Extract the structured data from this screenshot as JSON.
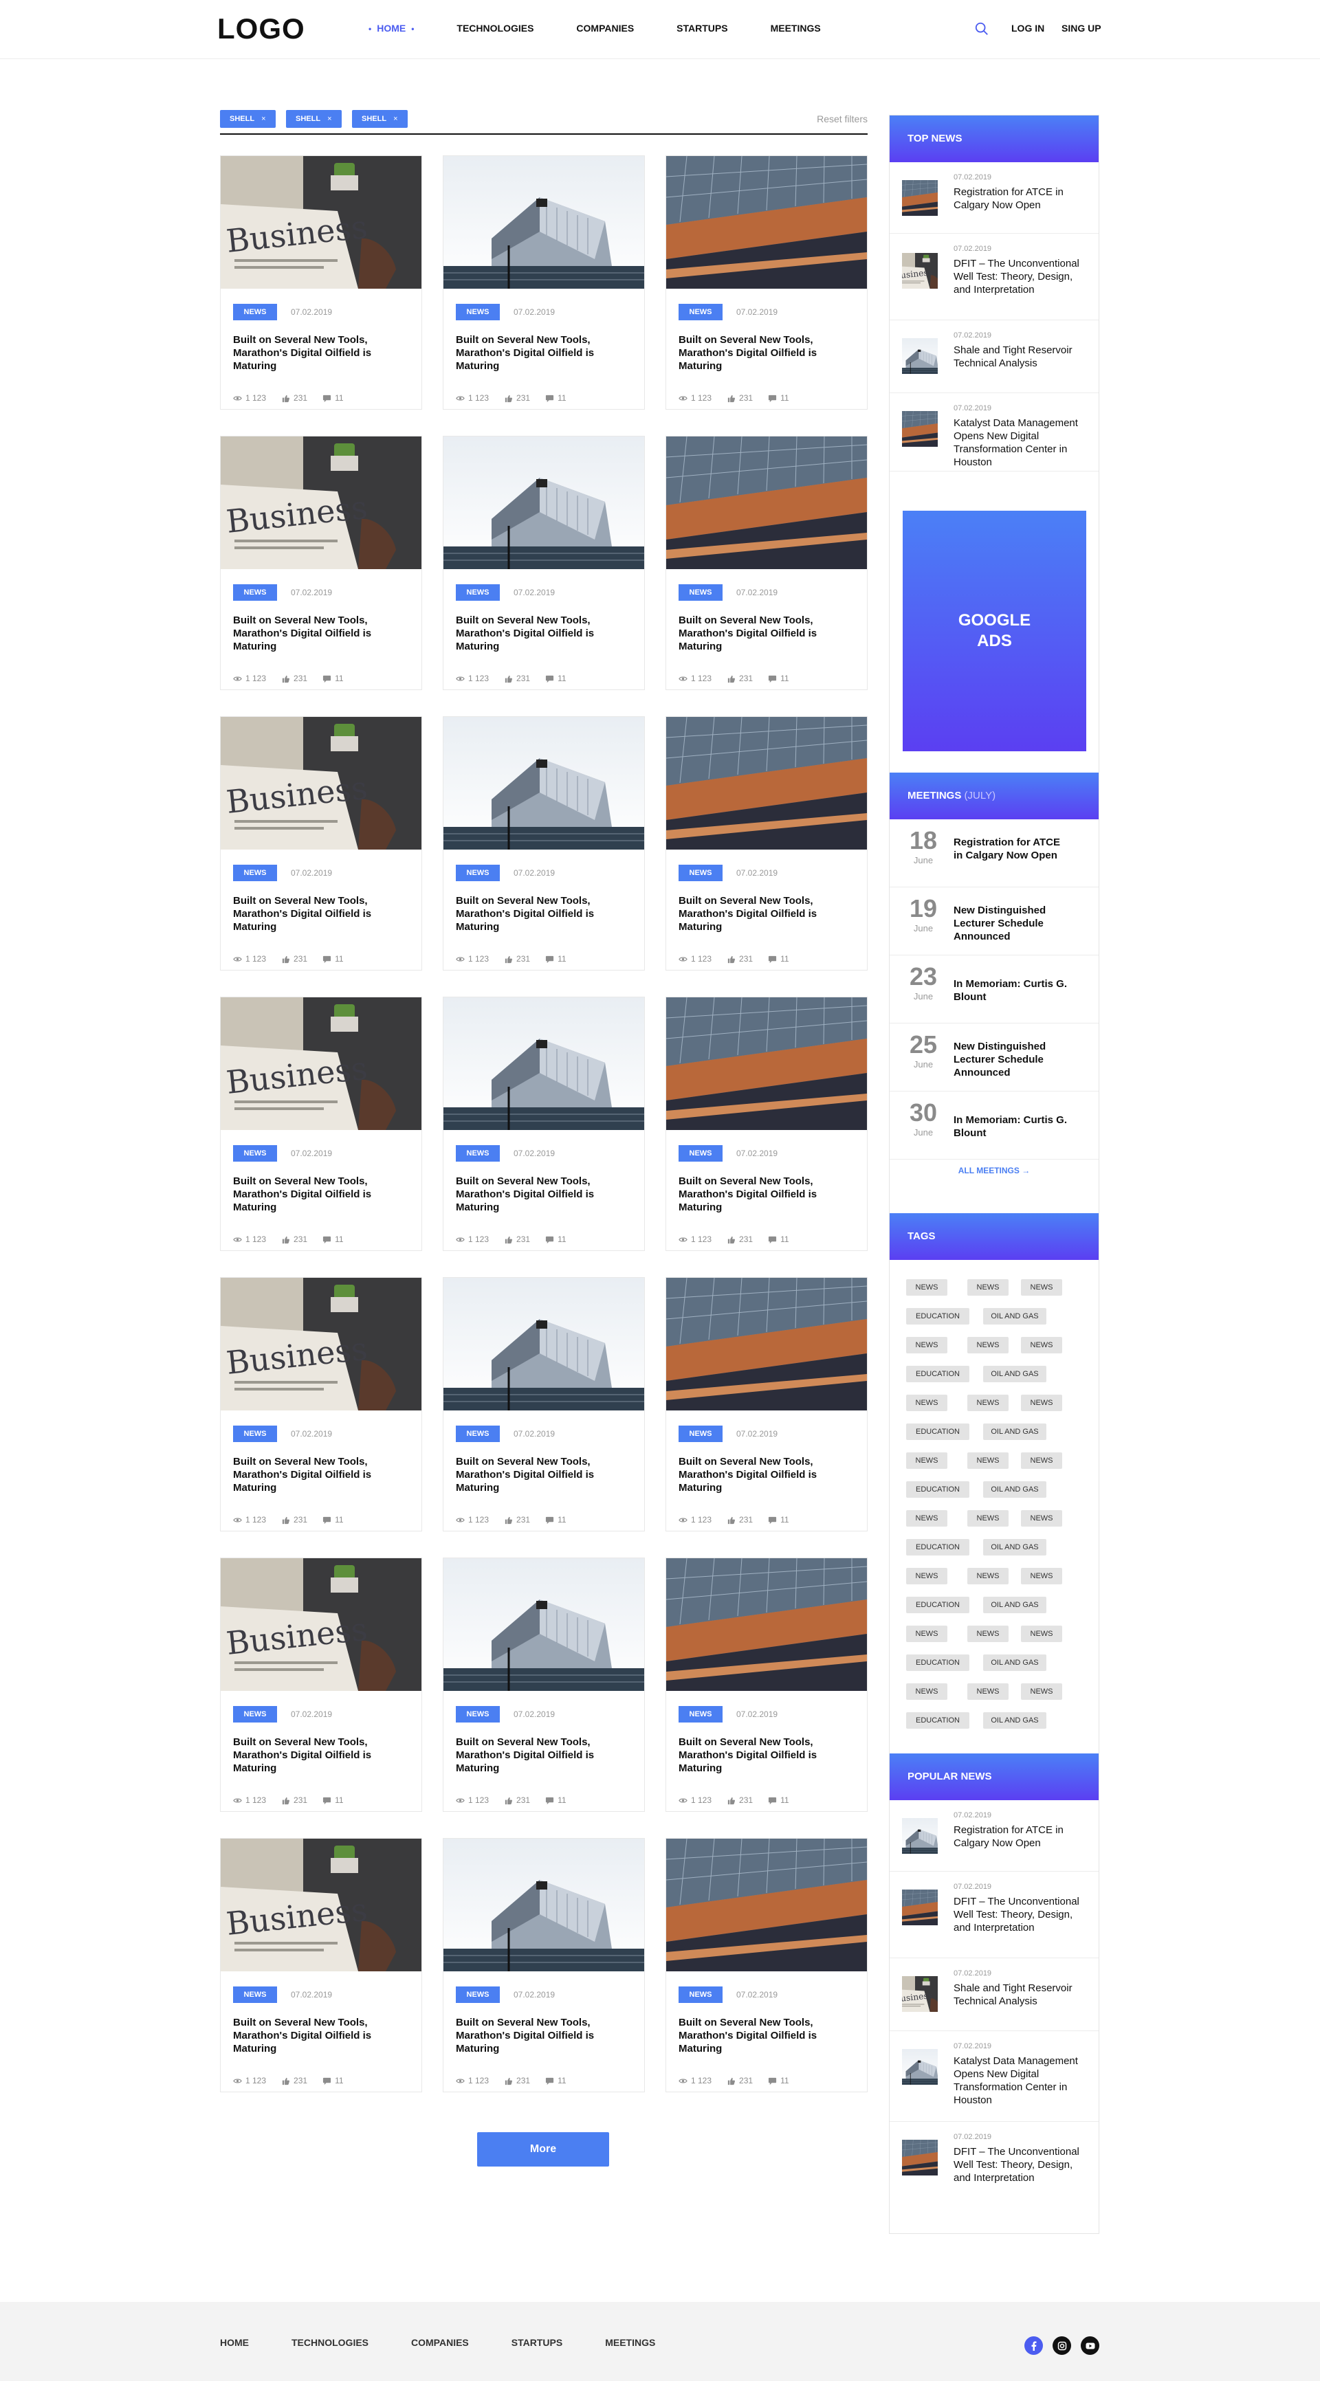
{
  "header": {
    "logo": "LOGO",
    "nav": [
      "HOME",
      "TECHNOLOGIES",
      "COMPANIES",
      "STARTUPS",
      "MEETINGS"
    ],
    "active_nav": "HOME",
    "login": "LOG IN",
    "signup": "SING UP"
  },
  "filters": {
    "chips": [
      "SHELL",
      "SHELL",
      "SHELL"
    ],
    "reset": "Reset filters"
  },
  "card": {
    "tag": "NEWS",
    "date": "07.02.2019",
    "title": "Built on Several New Tools, Marathon's Digital Oilfield is Maturing",
    "views": "1 123",
    "likes": "231",
    "comments": "11"
  },
  "more": "More",
  "top_news": {
    "heading": "TOP NEWS",
    "items": [
      {
        "date": "07.02.2019",
        "title": "Registration for ATCE in Calgary Now Open"
      },
      {
        "date": "07.02.2019",
        "title": "DFIT – The Unconventional Well Test: Theory, Design, and Interpretation"
      },
      {
        "date": "07.02.2019",
        "title": "Shale and Tight Reservoir Technical Analysis"
      },
      {
        "date": "07.02.2019",
        "title": "Katalyst Data Management Opens New Digital Transformation Center in Houston"
      }
    ]
  },
  "ads": "GOOGLE ADS",
  "meetings": {
    "heading": "MEETINGS",
    "heading_suffix": "(JULY)",
    "items": [
      {
        "day": "18",
        "month": "June",
        "title": "Registration for ATCE in Calgary Now Open"
      },
      {
        "day": "19",
        "month": "June",
        "title": "New Distinguished Lecturer Schedule Announced"
      },
      {
        "day": "23",
        "month": "June",
        "title": "In Memoriam: Curtis G. Blount"
      },
      {
        "day": "25",
        "month": "June",
        "title": "New Distinguished Lecturer Schedule Announced"
      },
      {
        "day": "30",
        "month": "June",
        "title": "In Memoriam: Curtis G. Blount"
      }
    ],
    "all": "ALL MEETINGS →"
  },
  "tags": {
    "heading": "TAGS",
    "row_a": [
      "NEWS",
      "NEWS",
      "NEWS"
    ],
    "row_b": [
      "EDUCATION",
      "OIL AND GAS"
    ]
  },
  "popular_news": {
    "heading": "POPULAR NEWS",
    "items": [
      {
        "date": "07.02.2019",
        "title": "Registration for ATCE in Calgary Now Open"
      },
      {
        "date": "07.02.2019",
        "title": "DFIT – The Unconventional Well Test: Theory, Design, and Interpretation"
      },
      {
        "date": "07.02.2019",
        "title": "Shale and Tight Reservoir Technical Analysis"
      },
      {
        "date": "07.02.2019",
        "title": "Katalyst Data Management Opens New Digital Transformation Center in Houston"
      },
      {
        "date": "07.02.2019",
        "title": "DFIT – The Unconventional Well Test: Theory, Design, and Interpretation"
      }
    ]
  },
  "footer": {
    "nav": [
      "HOME",
      "TECHNOLOGIES",
      "COMPANIES",
      "STARTUPS",
      "MEETINGS"
    ],
    "social": [
      "facebook-icon",
      "instagram-icon",
      "youtube-icon"
    ]
  },
  "colors": {
    "accent": "#4b7ff2",
    "gradient_end": "#5b3ff2"
  }
}
